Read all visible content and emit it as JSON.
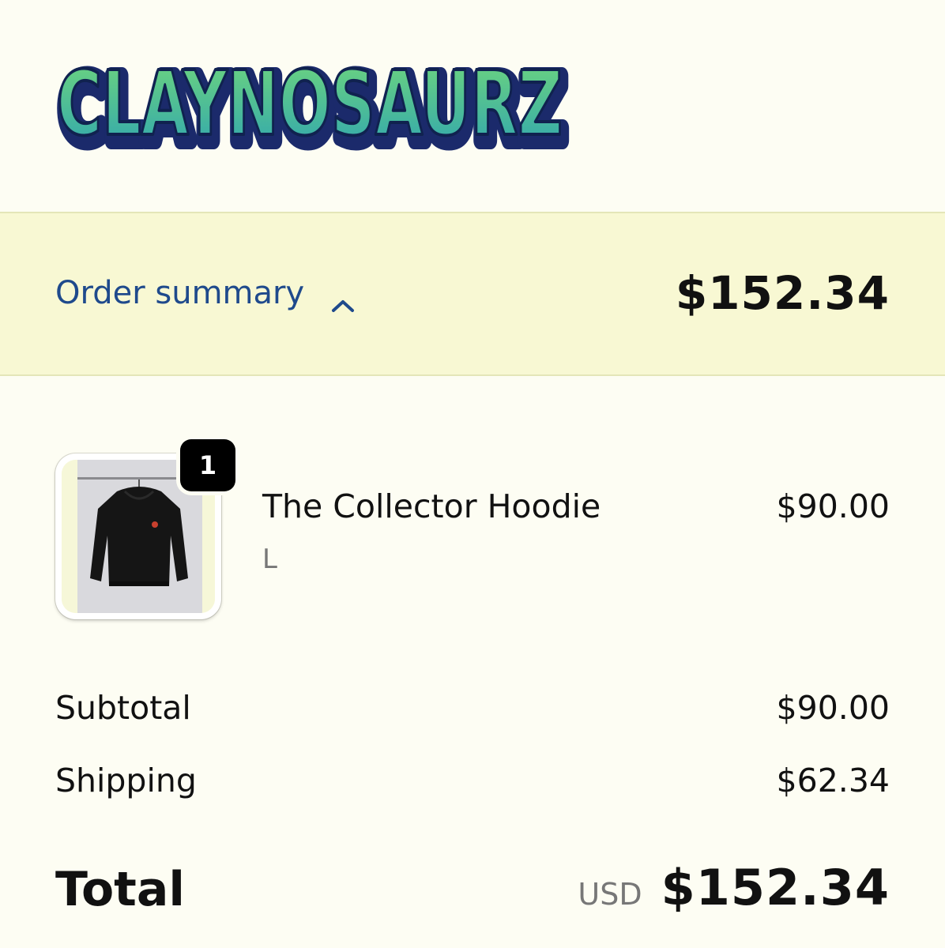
{
  "brand": {
    "logo_text": "CLAYNOSAURZ",
    "logo_colors": [
      "#5ecb7e",
      "#3fa6a8",
      "#1b2a6b"
    ]
  },
  "summary": {
    "toggle_label": "Order summary",
    "toggle_icon": "chevron-up-icon",
    "total": "$152.34"
  },
  "item": {
    "name": "The Collector Hoodie",
    "variant": "L",
    "price": "$90.00",
    "quantity": "1",
    "image": "black-hoodie-on-hanger"
  },
  "totals": {
    "subtotal_label": "Subtotal",
    "subtotal_value": "$90.00",
    "shipping_label": "Shipping",
    "shipping_value": "$62.34",
    "total_label": "Total",
    "currency": "USD",
    "total_value": "$152.34"
  },
  "colors": {
    "background": "#fdfdf3",
    "summary_bar": "#f8f8d3",
    "link": "#1f4a8c"
  }
}
